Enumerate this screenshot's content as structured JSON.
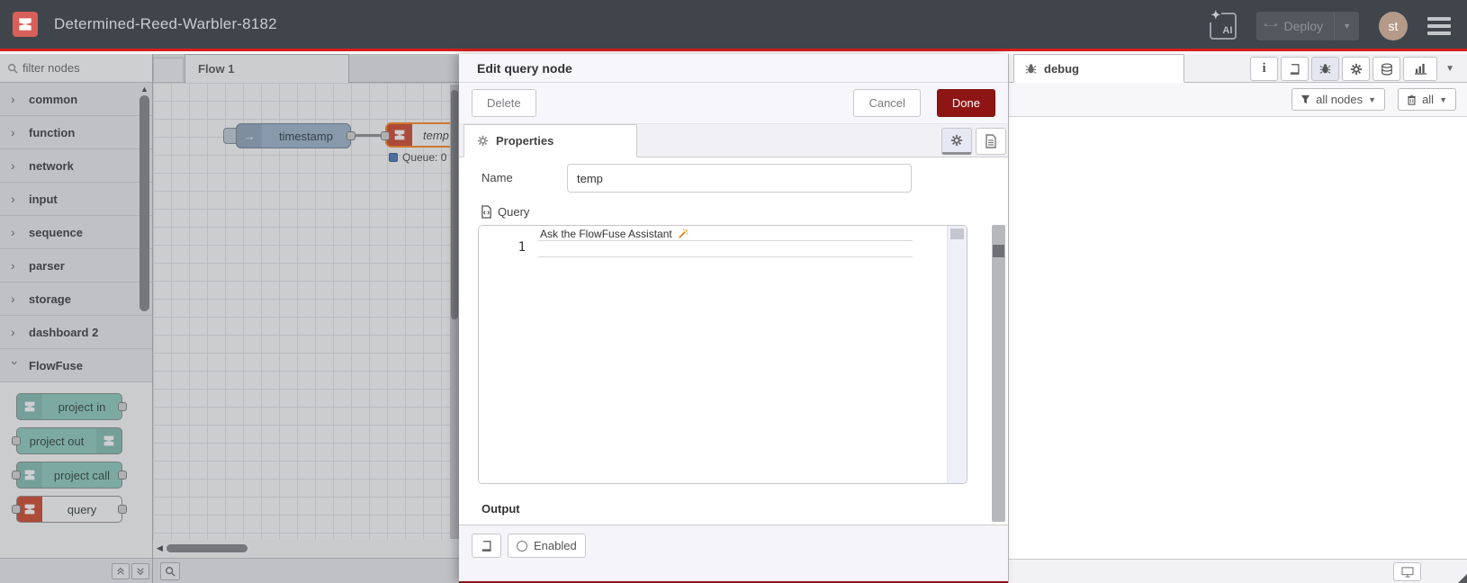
{
  "header": {
    "title": "Determined-Reed-Warbler-8182",
    "ai_button_label": "AI",
    "deploy_label": "Deploy",
    "avatar_initials": "st"
  },
  "palette": {
    "search_placeholder": "filter nodes",
    "categories": [
      {
        "label": "common",
        "expanded": false
      },
      {
        "label": "function",
        "expanded": false
      },
      {
        "label": "network",
        "expanded": false
      },
      {
        "label": "input",
        "expanded": false
      },
      {
        "label": "sequence",
        "expanded": false
      },
      {
        "label": "parser",
        "expanded": false
      },
      {
        "label": "storage",
        "expanded": false
      },
      {
        "label": "dashboard 2",
        "expanded": false
      },
      {
        "label": "FlowFuse",
        "expanded": true
      }
    ],
    "flowfuse_nodes": [
      {
        "label": "project in"
      },
      {
        "label": "project out"
      },
      {
        "label": "project call"
      },
      {
        "label": "query"
      }
    ]
  },
  "canvas": {
    "tab_label": "Flow 1",
    "inject_node_label": "timestamp",
    "query_node_label": "temp",
    "status_text": "Queue: 0"
  },
  "edit_panel": {
    "title": "Edit query node",
    "delete_label": "Delete",
    "cancel_label": "Cancel",
    "done_label": "Done",
    "properties_tab": "Properties",
    "name_label": "Name",
    "name_value": "temp",
    "query_label": "Query",
    "assistant_hint": "Ask the FlowFuse Assistant",
    "line_number": "1",
    "output_label": "Output",
    "enabled_label": "Enabled"
  },
  "debug_panel": {
    "tab_label": "debug",
    "filter_button_label": "all nodes",
    "clear_button_label": "all"
  },
  "colors": {
    "header_bg": "#40454c",
    "accent_red": "#d41f1f",
    "done_button_red": "#8f1515",
    "flowfuse_node_teal": "#98d1c5",
    "flowfuse_icon_red": "#d4583f",
    "selected_node_orange": "#ff9233",
    "inject_node_blue": "#a6bbcf",
    "status_blue": "#5a86c0"
  }
}
